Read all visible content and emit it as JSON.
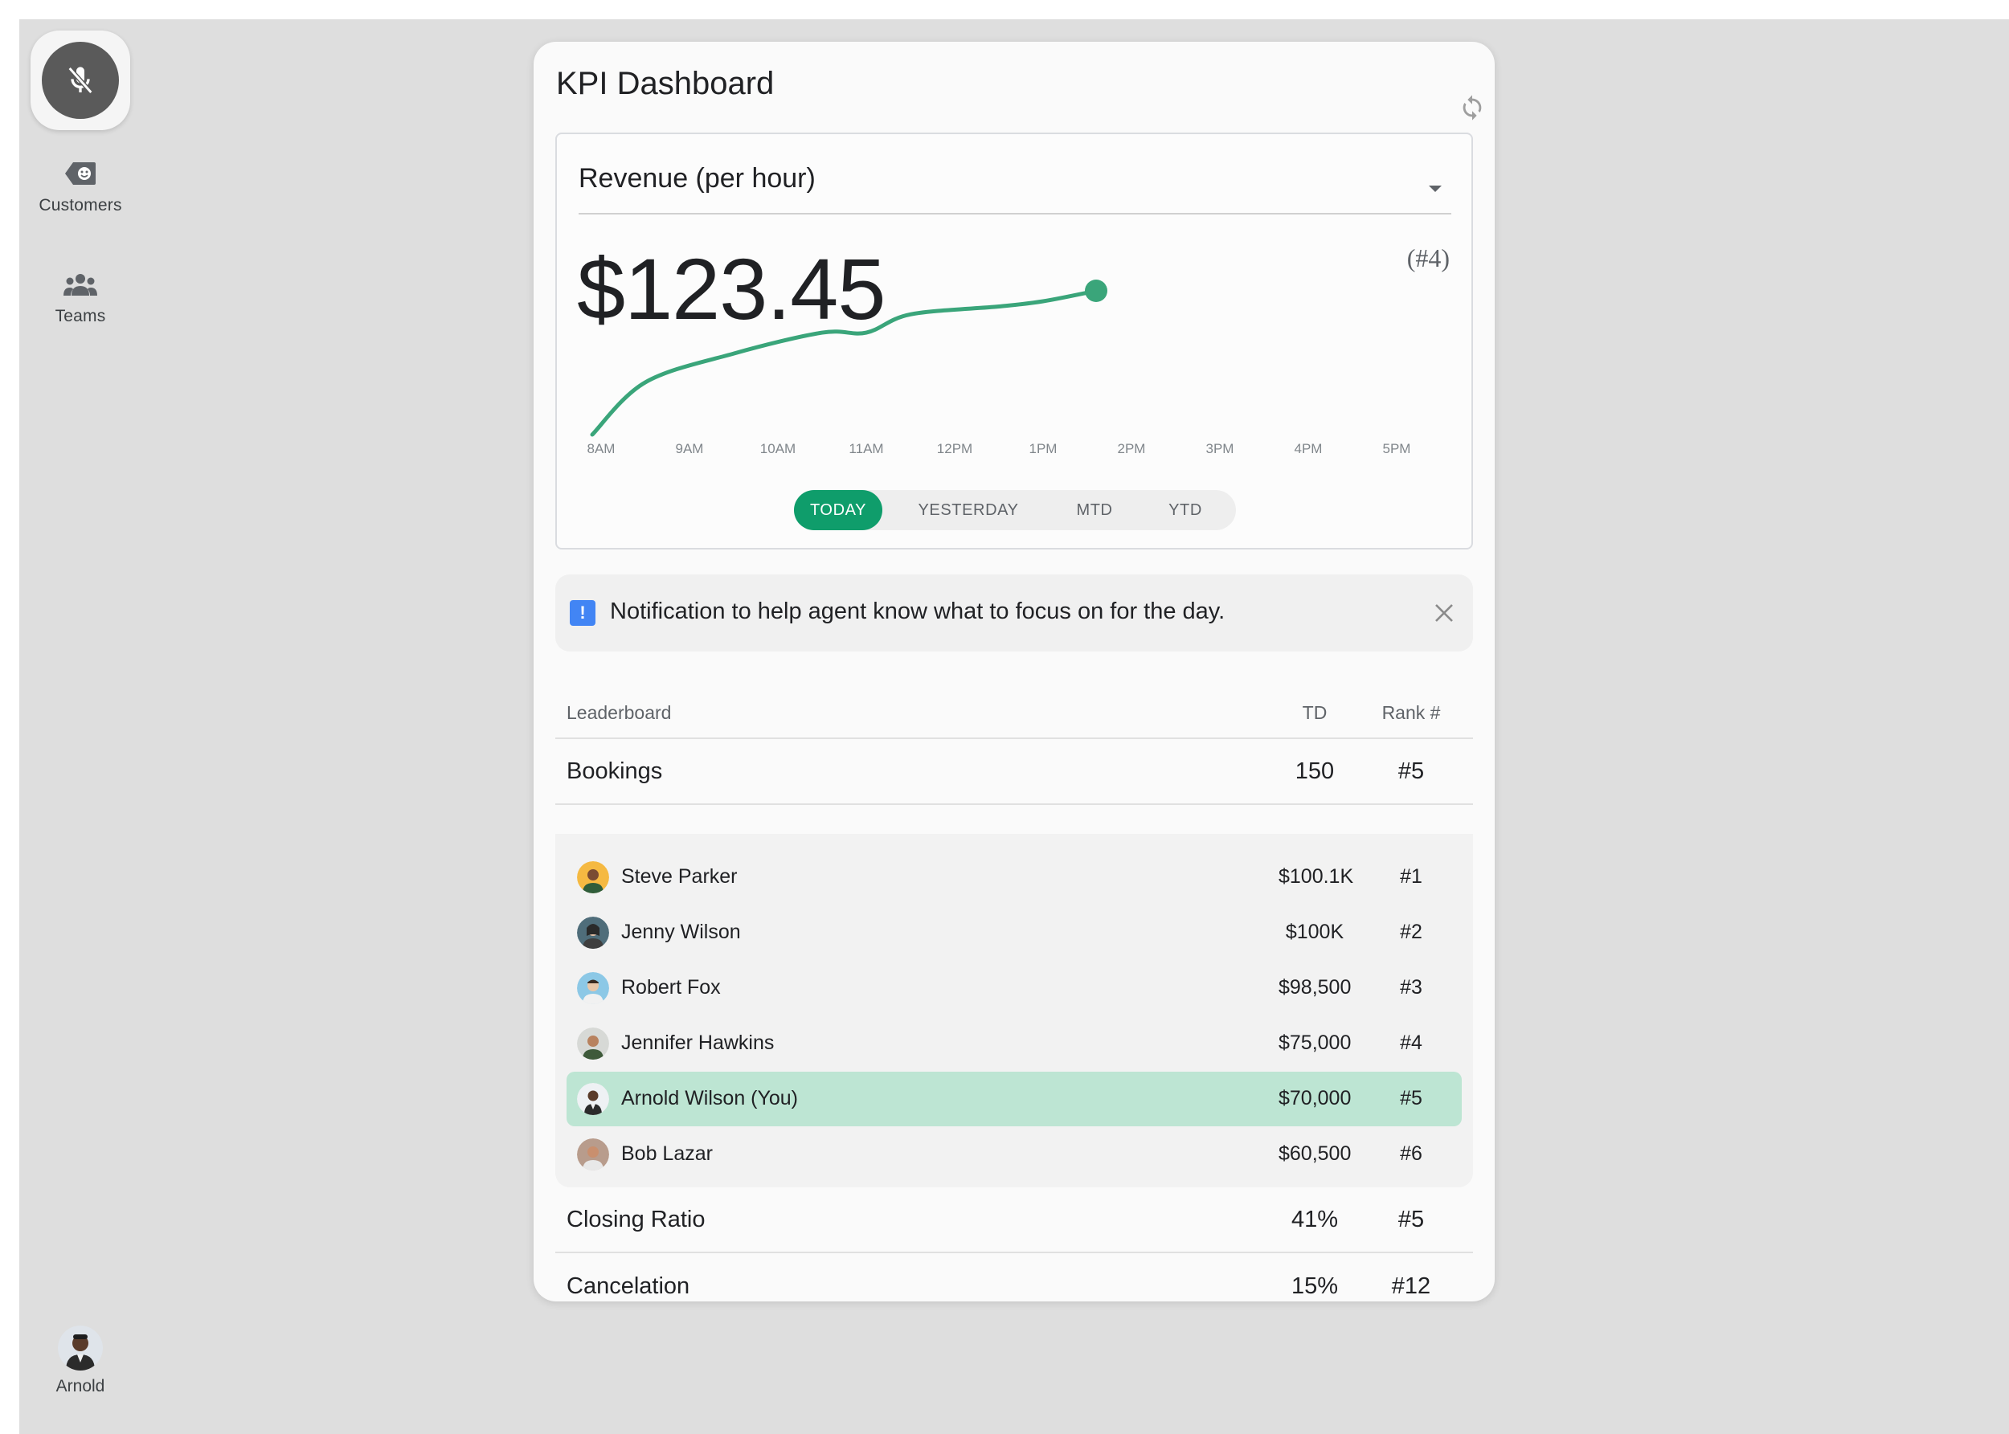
{
  "rail": {
    "mic_icon": "mic-off-icon",
    "items": [
      {
        "label": "Customers",
        "icon": "customer-tag-icon"
      },
      {
        "label": "Teams",
        "icon": "people-group-icon"
      }
    ],
    "profile": {
      "label": "Arnold"
    }
  },
  "card": {
    "title": "KPI Dashboard",
    "refresh_icon": "refresh-icon"
  },
  "kpi": {
    "metric_selected": "Revenue (per hour)",
    "value": "$123.45",
    "rank": "(#4)",
    "periods": [
      "TODAY",
      "YESTERDAY",
      "MTD",
      "YTD"
    ],
    "active_period": "TODAY"
  },
  "notice": {
    "text": "Notification to help agent know what to focus on for the day.",
    "icon": "alert-icon",
    "color": "#4285f4"
  },
  "leaderboard": {
    "header": {
      "name": "Leaderboard",
      "td": "TD",
      "rank": "Rank #"
    },
    "metrics": [
      {
        "name": "Bookings",
        "td": "150",
        "rank": "#5"
      },
      {
        "name": "Closing Ratio",
        "td": "41%",
        "rank": "#5"
      },
      {
        "name": "Cancelation",
        "td": "15%",
        "rank": "#12"
      }
    ],
    "people": [
      {
        "name": "Steve Parker",
        "value": "$100.1K",
        "rank": "#1",
        "avatar_color": "#f5b942"
      },
      {
        "name": "Jenny Wilson",
        "value": "$100K",
        "rank": "#2",
        "avatar_color": "#4f6d7a"
      },
      {
        "name": "Robert Fox",
        "value": "$98,500",
        "rank": "#3",
        "avatar_color": "#8cc8e6"
      },
      {
        "name": "Jennifer Hawkins",
        "value": "$75,000",
        "rank": "#4",
        "avatar_color": "#8a9a8a"
      },
      {
        "name": "Arnold Wilson (You)",
        "value": "$70,000",
        "rank": "#5",
        "avatar_color": "#d8dde3",
        "highlight": true
      },
      {
        "name": "Bob Lazar",
        "value": "$60,500",
        "rank": "#6",
        "avatar_color": "#b89c8c"
      }
    ],
    "highlight_color": "#bde5d3"
  },
  "chart_data": {
    "type": "line",
    "categories": [
      "8AM",
      "9AM",
      "10AM",
      "11AM",
      "12PM",
      "1PM",
      "2PM",
      "3PM",
      "4PM",
      "5PM"
    ],
    "series": [
      {
        "values": [
          0.22,
          0.45,
          0.62,
          0.78,
          0.83,
          0.88
        ]
      }
    ],
    "x_points": [
      7.9,
      8.5,
      9.5,
      10.5,
      11.0,
      11.5,
      12.5,
      13.0,
      13.6
    ],
    "y_points": [
      0.0,
      0.4,
      0.62,
      0.78,
      0.78,
      0.92,
      0.98,
      1.02,
      1.1
    ],
    "color": "#3aa57a",
    "end_marker": true,
    "title": "",
    "xlabel": "",
    "ylabel": ""
  },
  "colors": {
    "accent": "#0f9d6b",
    "line": "#3aa57a"
  }
}
